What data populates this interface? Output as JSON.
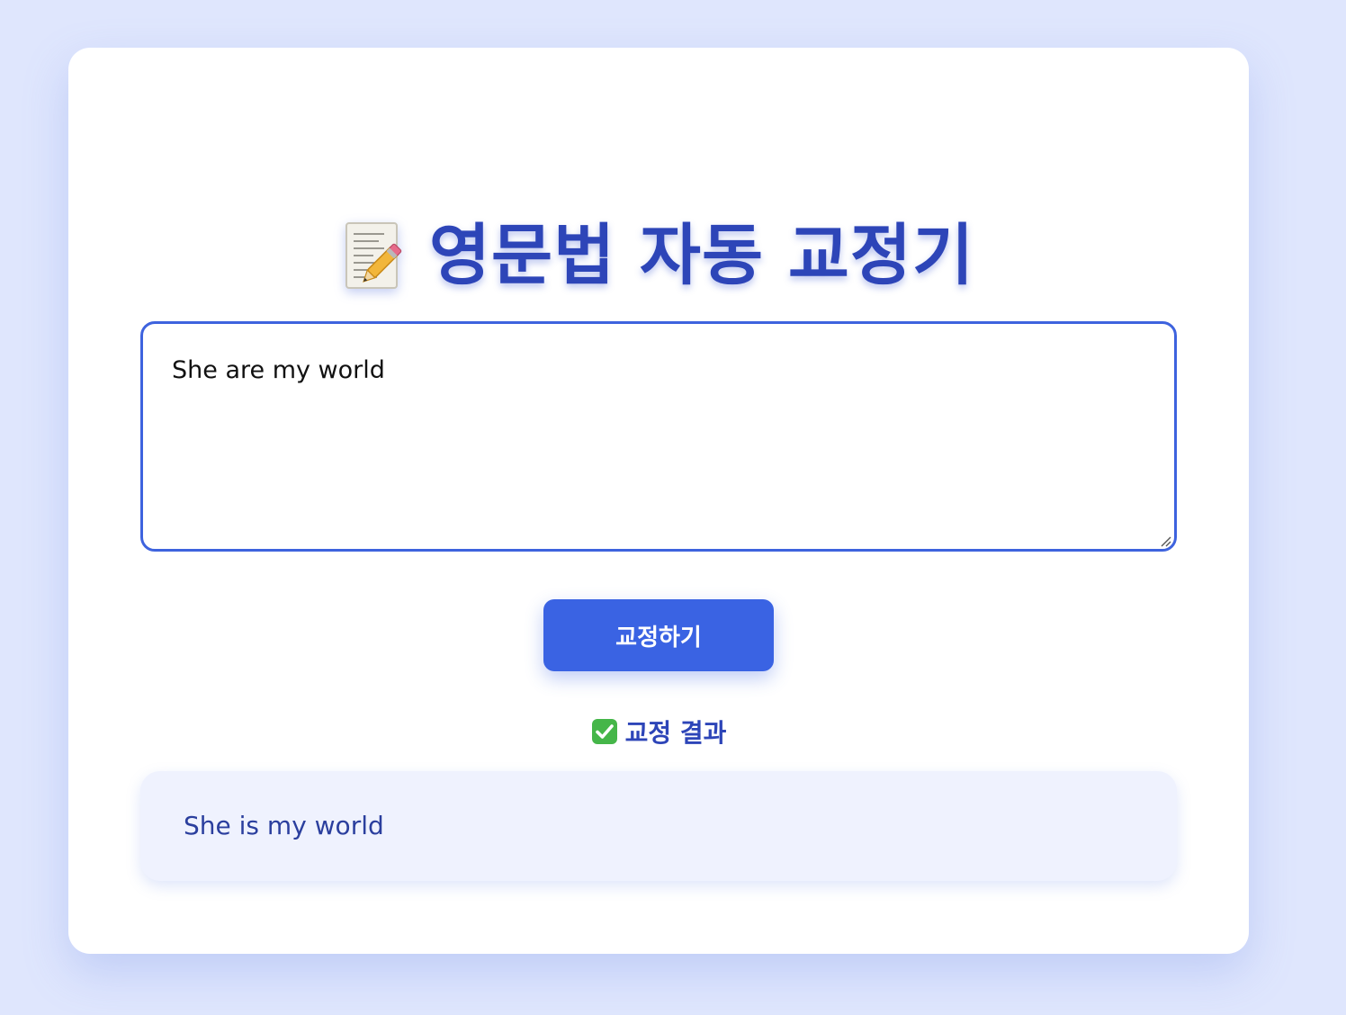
{
  "page": {
    "background_color": "#dfe6fd",
    "accent_color": "#3a63e3",
    "title_color": "#2d45b8"
  },
  "header": {
    "icon": "memo-pencil-icon",
    "title": "영문법 자동 교정기"
  },
  "input": {
    "value": "She are my world"
  },
  "actions": {
    "correct_label": "교정하기"
  },
  "result": {
    "icon": "check-mark-icon",
    "heading": "교정 결과",
    "text": "She is my world"
  }
}
